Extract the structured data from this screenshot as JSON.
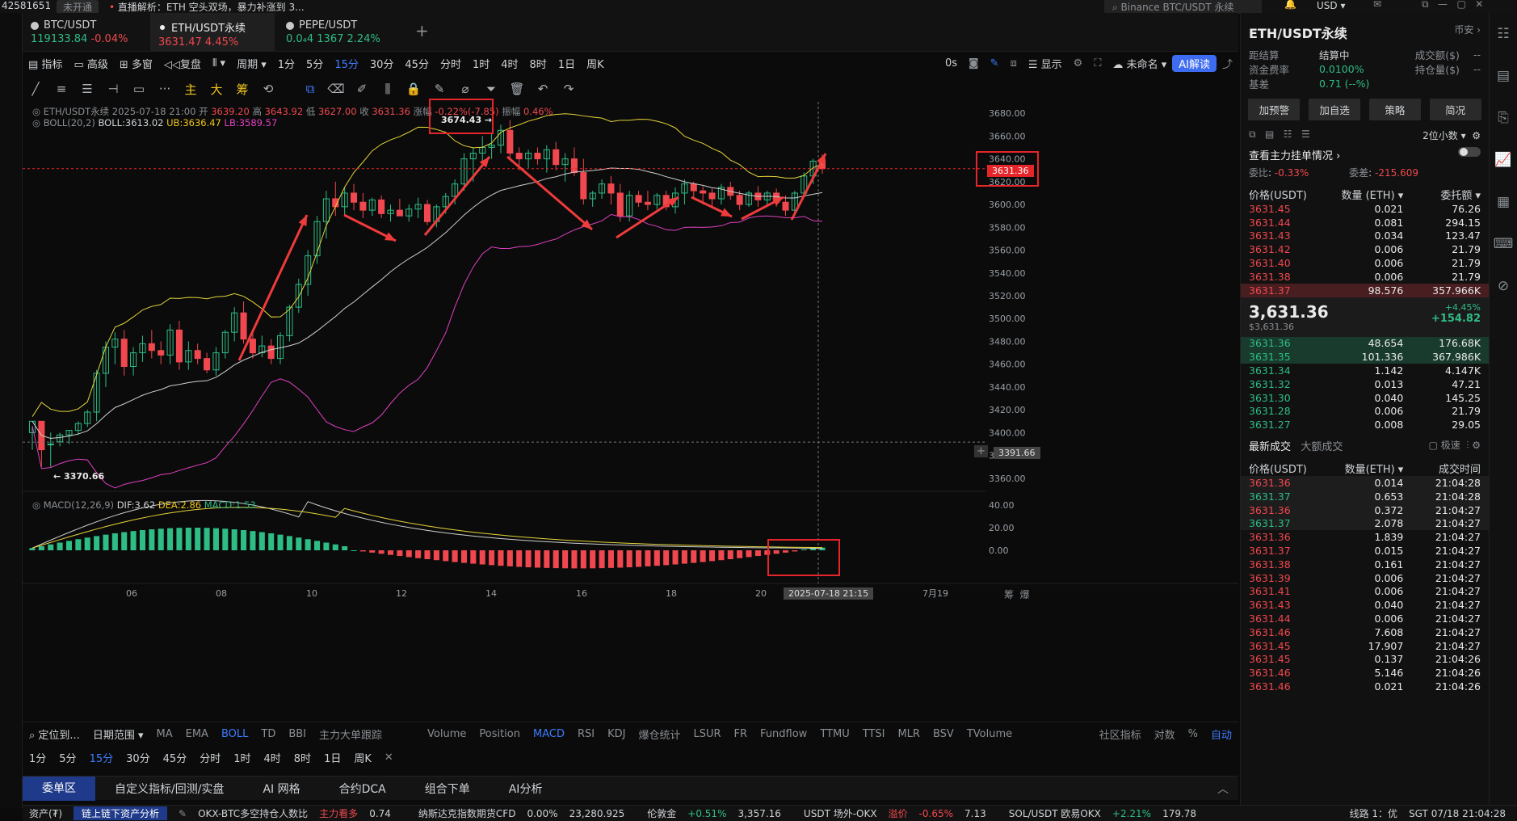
{
  "topbar": {
    "account": "42581651",
    "status": "未开通",
    "news": "直播解析：ETH 空头双场，暴力补涨到 3...",
    "search": "Binance BTC/USDT 永续",
    "currency": "USD"
  },
  "tabs": [
    {
      "name": "BTC/USDT",
      "value": "119133.84",
      "change": "-0.04%"
    },
    {
      "name": "ETH/USDT永续",
      "value": "3631.47",
      "change": "4.45%"
    },
    {
      "name": "PEPE/USDT",
      "value": "0.0₄4 1367",
      "change": "2.24%"
    }
  ],
  "toolbar1": [
    "指标",
    "高级",
    "多窗",
    "复盘",
    "",
    "周期",
    "1分",
    "5分",
    "15分",
    "30分",
    "45分",
    "分时",
    "1时",
    "4时",
    "8时",
    "1日",
    "周K"
  ],
  "toolbar1_right": {
    "countdown": "0s",
    "display": "显示",
    "unnamed": "未命名",
    "ai": "AI解读"
  },
  "toolbar2_labels": [
    "主",
    "大",
    "筹"
  ],
  "chart": {
    "title": "ETH/USDT永续",
    "datetime": "2025-07-18 21:00",
    "open": "3639.20",
    "high": "3643.92",
    "low": "3627.00",
    "close": "3631.36",
    "change": "-0.22%(-7.85)",
    "amplitude": "0.46%",
    "open_label": "开",
    "high_label": "高",
    "low_label": "低",
    "close_label": "收",
    "change_label": "涨幅",
    "amp_label": "振幅",
    "boll_label": "BOLL(20,2)",
    "boll": "BOLL:3613.02",
    "ub": "UB:3636.47",
    "lb": "LB:3589.57",
    "macd_label": "MACD(12,26,9)",
    "dif": "DIF:3.62",
    "dea": "DEA:2.86",
    "macd": "MACD:1.53",
    "high_marker": "3674.43 →",
    "low_marker": "← 3370.66",
    "last_price": "3631.36",
    "cross_price": "3391.66",
    "cross_time": "2025-07-18 21:15",
    "yticks": [
      "3680.00",
      "3660.00",
      "3640.00",
      "3620.00",
      "3600.00",
      "3580.00",
      "3560.00",
      "3540.00",
      "3520.00",
      "3500.00",
      "3480.00",
      "3460.00",
      "3440.00",
      "3420.00",
      "3400.00",
      "3380.00",
      "3360.00"
    ],
    "macd_ticks": [
      "40.00",
      "20.00",
      "0.00"
    ],
    "xticks": [
      "06",
      "08",
      "10",
      "12",
      "14",
      "16",
      "18",
      "20",
      "7月19"
    ],
    "corner": [
      "筹",
      "爆"
    ]
  },
  "chart_data": {
    "type": "candlestick",
    "ylim": [
      3350,
      3690
    ],
    "last": 3631.36,
    "high": 3674.43,
    "low": 3370.66
  },
  "bottom1": {
    "locate": "定位到...",
    "range": "日期范围",
    "indicators": [
      "MA",
      "EMA",
      "BOLL",
      "TD",
      "BBI",
      "主力大单跟踪"
    ],
    "sub": [
      "Volume",
      "Position",
      "MACD",
      "RSI",
      "KDJ",
      "爆仓统计",
      "LSUR",
      "FR",
      "Fundflow",
      "TTMU",
      "TTSI",
      "MLR",
      "BSV",
      "TVolume"
    ],
    "right": [
      "社区指标",
      "对数",
      "%",
      "自动"
    ]
  },
  "bottom2": [
    "1分",
    "5分",
    "15分",
    "30分",
    "45分",
    "分时",
    "1时",
    "4时",
    "8时",
    "1日",
    "周K",
    "✕"
  ],
  "paneltabs": [
    "委单区",
    "自定义指标/回测/实盘",
    "AI 网格",
    "合约DCA",
    "组合下单",
    "AI分析"
  ],
  "status": {
    "asset": "资产(₮)",
    "link": "链上链下资产分析",
    "items": [
      "OKX-BTC多空持仓人数比",
      "主力看多",
      "0.74",
      "纳斯达克指数期货CFD",
      "0.00%",
      "23,280.925",
      "伦敦金",
      "+0.51%",
      "3,357.16",
      "USDT 场外-OKX",
      "溢价",
      "-0.65%",
      "7.13",
      "SOL/USDT 欧易OKX",
      "+2.21%",
      "179.78"
    ],
    "line": "线路 1：优",
    "time": "SGT 07/18 21:04:28"
  },
  "rpanel": {
    "title": "ETH/USDT永续",
    "right": "币安",
    "info": [
      [
        "距结算",
        "结算中",
        "成交额($)",
        "--"
      ],
      [
        "资金费率",
        "0.0100%",
        "持仓量($)",
        "--"
      ],
      [
        "基差",
        "0.71 (--%)",
        "",
        ""
      ]
    ],
    "buttons": [
      "加预警",
      "加自选",
      "策略",
      "简况"
    ],
    "precision": "2位小数",
    "mainorders": "查看主力挂单情况",
    "ratio_label": "委比",
    "ratio": "-0.33%",
    "diff_label": "委差",
    "diff": "-215.609",
    "headers": [
      "价格(USDT)",
      "数量 (ETH)",
      "委托额"
    ],
    "asks": [
      [
        "3631.45",
        "0.021",
        "76.26"
      ],
      [
        "3631.44",
        "0.081",
        "294.15"
      ],
      [
        "3631.43",
        "0.034",
        "123.47"
      ],
      [
        "3631.42",
        "0.006",
        "21.79"
      ],
      [
        "3631.40",
        "0.006",
        "21.79"
      ],
      [
        "3631.38",
        "0.006",
        "21.79"
      ],
      [
        "3631.37",
        "98.576",
        "357.966K"
      ]
    ],
    "mid": "3,631.36",
    "mid_sub": "$3,631.36",
    "mid_chg": "+4.45%",
    "mid_abs": "+154.82",
    "bids": [
      [
        "3631.36",
        "48.654",
        "176.68K"
      ],
      [
        "3631.35",
        "101.336",
        "367.986K"
      ],
      [
        "3631.34",
        "1.142",
        "4.147K"
      ],
      [
        "3631.32",
        "0.013",
        "47.21"
      ],
      [
        "3631.30",
        "0.040",
        "145.25"
      ],
      [
        "3631.28",
        "0.006",
        "21.79"
      ],
      [
        "3631.27",
        "0.008",
        "29.05"
      ]
    ],
    "trades_tab": "最新成交",
    "trades_tab2": "大额成交",
    "fast": "极速",
    "trade_headers": [
      "价格(USDT)",
      "数量(ETH)",
      "成交时间"
    ],
    "trades": [
      [
        "3631.36",
        "0.014",
        "21:04:28",
        "r"
      ],
      [
        "3631.37",
        "0.653",
        "21:04:28",
        "g"
      ],
      [
        "3631.36",
        "0.372",
        "21:04:27",
        "r"
      ],
      [
        "3631.37",
        "2.078",
        "21:04:27",
        "g"
      ],
      [
        "3631.36",
        "1.839",
        "21:04:27",
        "r"
      ],
      [
        "3631.37",
        "0.015",
        "21:04:27",
        "r"
      ],
      [
        "3631.38",
        "0.161",
        "21:04:27",
        "r"
      ],
      [
        "3631.39",
        "0.006",
        "21:04:27",
        "r"
      ],
      [
        "3631.41",
        "0.006",
        "21:04:27",
        "r"
      ],
      [
        "3631.43",
        "0.040",
        "21:04:27",
        "r"
      ],
      [
        "3631.44",
        "0.006",
        "21:04:27",
        "r"
      ],
      [
        "3631.46",
        "7.608",
        "21:04:27",
        "r"
      ],
      [
        "3631.45",
        "17.907",
        "21:04:27",
        "r"
      ],
      [
        "3631.45",
        "0.137",
        "21:04:26",
        "r"
      ],
      [
        "3631.46",
        "5.146",
        "21:04:26",
        "r"
      ],
      [
        "3631.46",
        "0.021",
        "21:04:26",
        "r"
      ]
    ]
  }
}
